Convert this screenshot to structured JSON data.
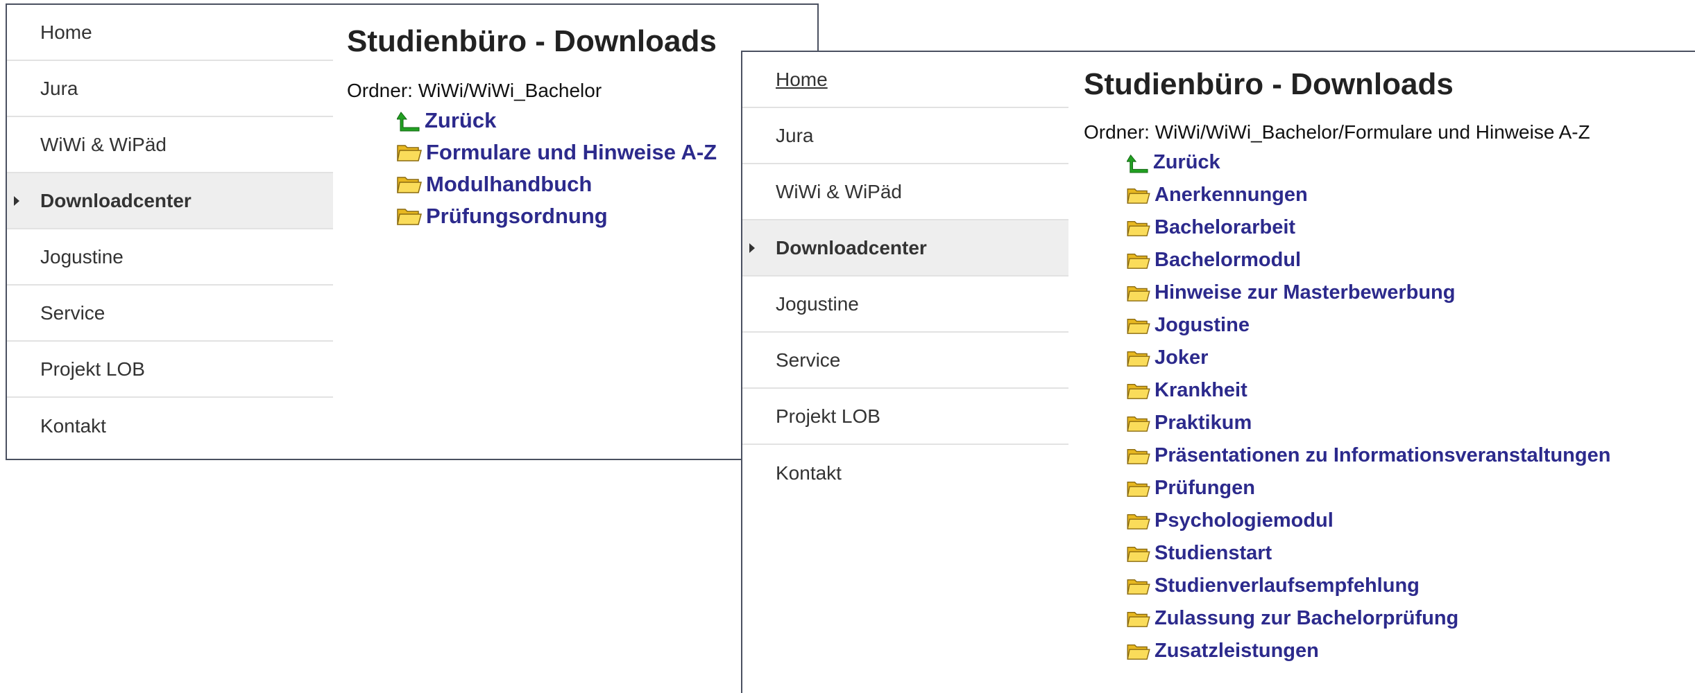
{
  "left_window": {
    "nav": [
      {
        "label": "Home"
      },
      {
        "label": "Jura"
      },
      {
        "label": "WiWi & WiPäd"
      },
      {
        "label": "Downloadcenter",
        "active": true
      },
      {
        "label": "Jogustine"
      },
      {
        "label": "Service"
      },
      {
        "label": "Projekt LOB"
      },
      {
        "label": "Kontakt"
      }
    ],
    "title": "Studienbüro - Downloads",
    "folder": "Ordner: WiWi/WiWi_Bachelor",
    "back_label": "Zurück",
    "folders": [
      "Formulare und Hinweise A-Z",
      "Modulhandbuch",
      "Prüfungsordnung"
    ]
  },
  "right_window": {
    "nav": [
      {
        "label": "Home"
      },
      {
        "label": "Jura"
      },
      {
        "label": "WiWi & WiPäd"
      },
      {
        "label": "Downloadcenter",
        "active": true
      },
      {
        "label": "Jogustine"
      },
      {
        "label": "Service"
      },
      {
        "label": "Projekt LOB"
      },
      {
        "label": "Kontakt"
      }
    ],
    "title": "Studienbüro - Downloads",
    "folder": "Ordner: WiWi/WiWi_Bachelor/Formulare und Hinweise A-Z",
    "back_label": "Zurück",
    "folders": [
      "Anerkennungen",
      "Bachelorarbeit",
      "Bachelormodul",
      "Hinweise zur Masterbewerbung",
      "Jogustine",
      "Joker",
      "Krankheit",
      "Praktikum",
      "Präsentationen zu Informationsveranstaltungen",
      "Prüfungen",
      "Psychologiemodul",
      "Studienstart",
      "Studienverlaufsempfehlung",
      "Zulassung zur Bachelorprüfung",
      "Zusatzleistungen"
    ]
  },
  "icons": {
    "back": "green-up-arrow-icon",
    "folder": "folder-icon"
  },
  "colors": {
    "link": "#2c2a8c",
    "active_nav_bg": "#eeeeee",
    "folder": "#f0c830",
    "back_arrow": "#22a022"
  }
}
